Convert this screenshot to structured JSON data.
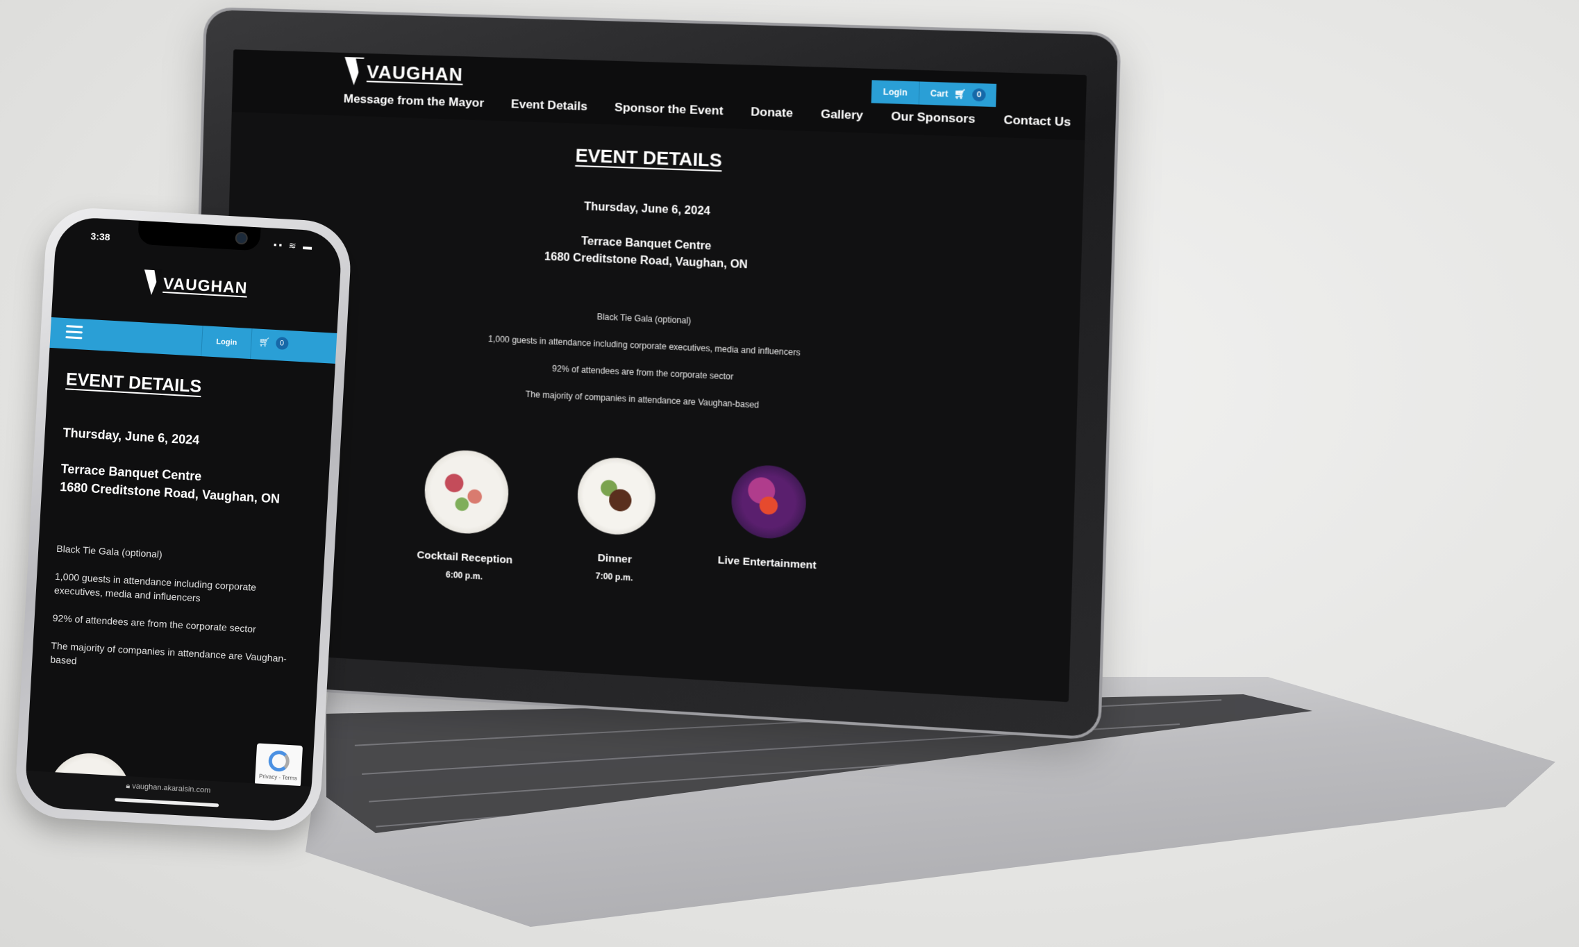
{
  "brand": {
    "logo_text": "VAUGHAN"
  },
  "desktop": {
    "utility": {
      "login": "Login",
      "cart": "Cart",
      "cart_count": "0"
    },
    "nav": [
      "Message from the Mayor",
      "Event Details",
      "Sponsor the Event",
      "Donate",
      "Gallery",
      "Our Sponsors",
      "Contact Us"
    ],
    "page_title": "EVENT DETAILS",
    "date": "Thursday, June 6, 2024",
    "venue_name": "Terrace Banquet Centre",
    "venue_address": "1680 Creditstone Road, Vaughan, ON",
    "bullets": [
      "Black Tie Gala (optional)",
      "1,000 guests in attendance including corporate executives, media and influencers",
      "92% of attendees are from the corporate sector",
      "The majority of companies in attendance are Vaughan-based"
    ],
    "cards": [
      {
        "title": "Cocktail Reception",
        "time": "6:00 p.m."
      },
      {
        "title": "Dinner",
        "time": "7:00 p.m."
      },
      {
        "title": "Live Entertainment",
        "time": ""
      }
    ]
  },
  "mobile": {
    "status_time": "3:38",
    "status_icons": "▪︎▪︎ ≋ ▬",
    "login": "Login",
    "cart_count": "0",
    "page_title": "EVENT DETAILS",
    "date": "Thursday, June 6, 2024",
    "venue_name": "Terrace Banquet Centre",
    "venue_address": "1680 Creditstone Road, Vaughan, ON",
    "bullets": [
      "Black Tie Gala (optional)",
      "1,000 guests in attendance including corporate executives, media and influencers",
      "92% of attendees are from the corporate sector",
      "The majority of companies in attendance are Vaughan-based"
    ],
    "recaptcha_text": "Privacy - Terms",
    "url": "vaughan.akaraisin.com"
  },
  "colors": {
    "accent": "#2a9fd6",
    "screen_bg": "#111112"
  },
  "icons": {
    "cart": "cart-icon",
    "menu": "hamburger-menu-icon",
    "lock": "lock-icon"
  }
}
